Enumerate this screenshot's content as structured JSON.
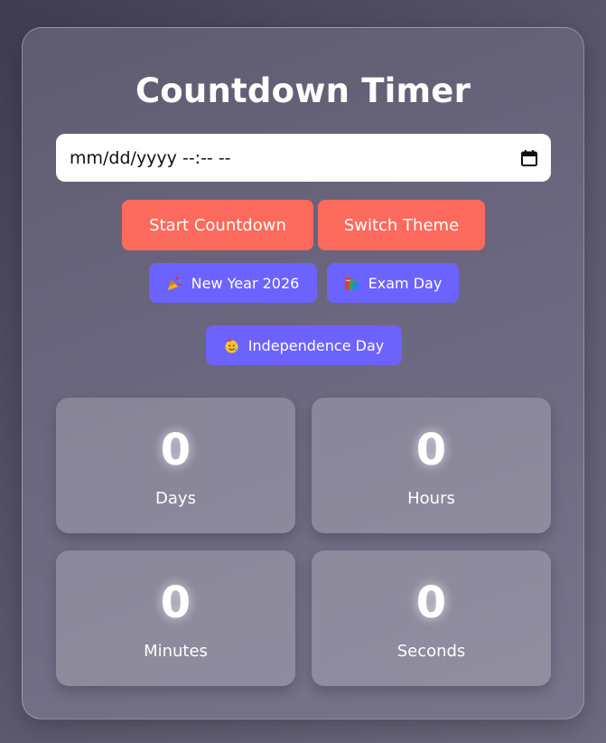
{
  "title": "Countdown Timer",
  "date_input": {
    "placeholder": "mm/dd/yyyy --:-- --",
    "icon": "calendar-icon"
  },
  "buttons": {
    "start": "Start Countdown",
    "theme": "Switch Theme"
  },
  "presets": [
    {
      "label": "New Year 2026",
      "icon": "party-popper-icon"
    },
    {
      "label": "Exam Day",
      "icon": "books-icon"
    },
    {
      "label": "Independence Day",
      "icon": "party-face-icon"
    }
  ],
  "countdown": {
    "days": {
      "value": "0",
      "label": "Days"
    },
    "hours": {
      "value": "0",
      "label": "Hours"
    },
    "minutes": {
      "value": "0",
      "label": "Minutes"
    },
    "seconds": {
      "value": "0",
      "label": "Seconds"
    }
  },
  "colors": {
    "accent_coral": "#fb6a5c",
    "accent_purple": "#6c63ff"
  }
}
